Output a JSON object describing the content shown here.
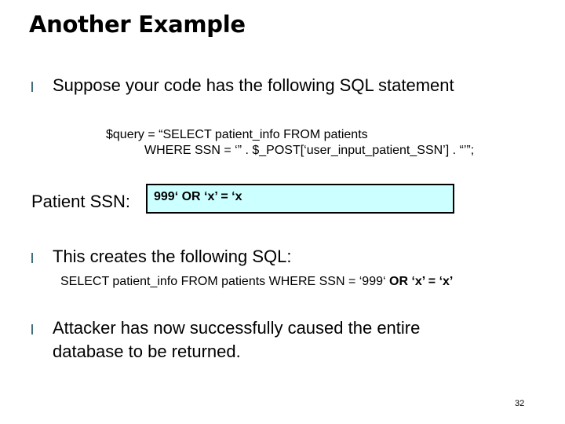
{
  "slide": {
    "title": "Another Example",
    "bullets": [
      {
        "text": "Suppose your code has the following SQL statement"
      },
      {
        "text": "This creates the following SQL:"
      },
      {
        "line1": "Attacker has now successfully caused the entire",
        "line2": "database to be returned."
      }
    ],
    "code": {
      "line1": "$query = “SELECT patient_info FROM patients",
      "line2": "WHERE SSN = ‘” . $_POST[‘user_input_patient_SSN’] . “’”;"
    },
    "form": {
      "label": "Patient SSN:",
      "input_value": "999‘ OR ‘x’ = ‘x",
      "input_bg_color": "#ccffff"
    },
    "resulting_sql": {
      "plain": "SELECT patient_info FROM patients WHERE SSN = ‘999‘ ",
      "bold": "OR ‘x’ = ‘x’"
    },
    "page_number": "32",
    "bullet_color": "#3f6f7f"
  }
}
